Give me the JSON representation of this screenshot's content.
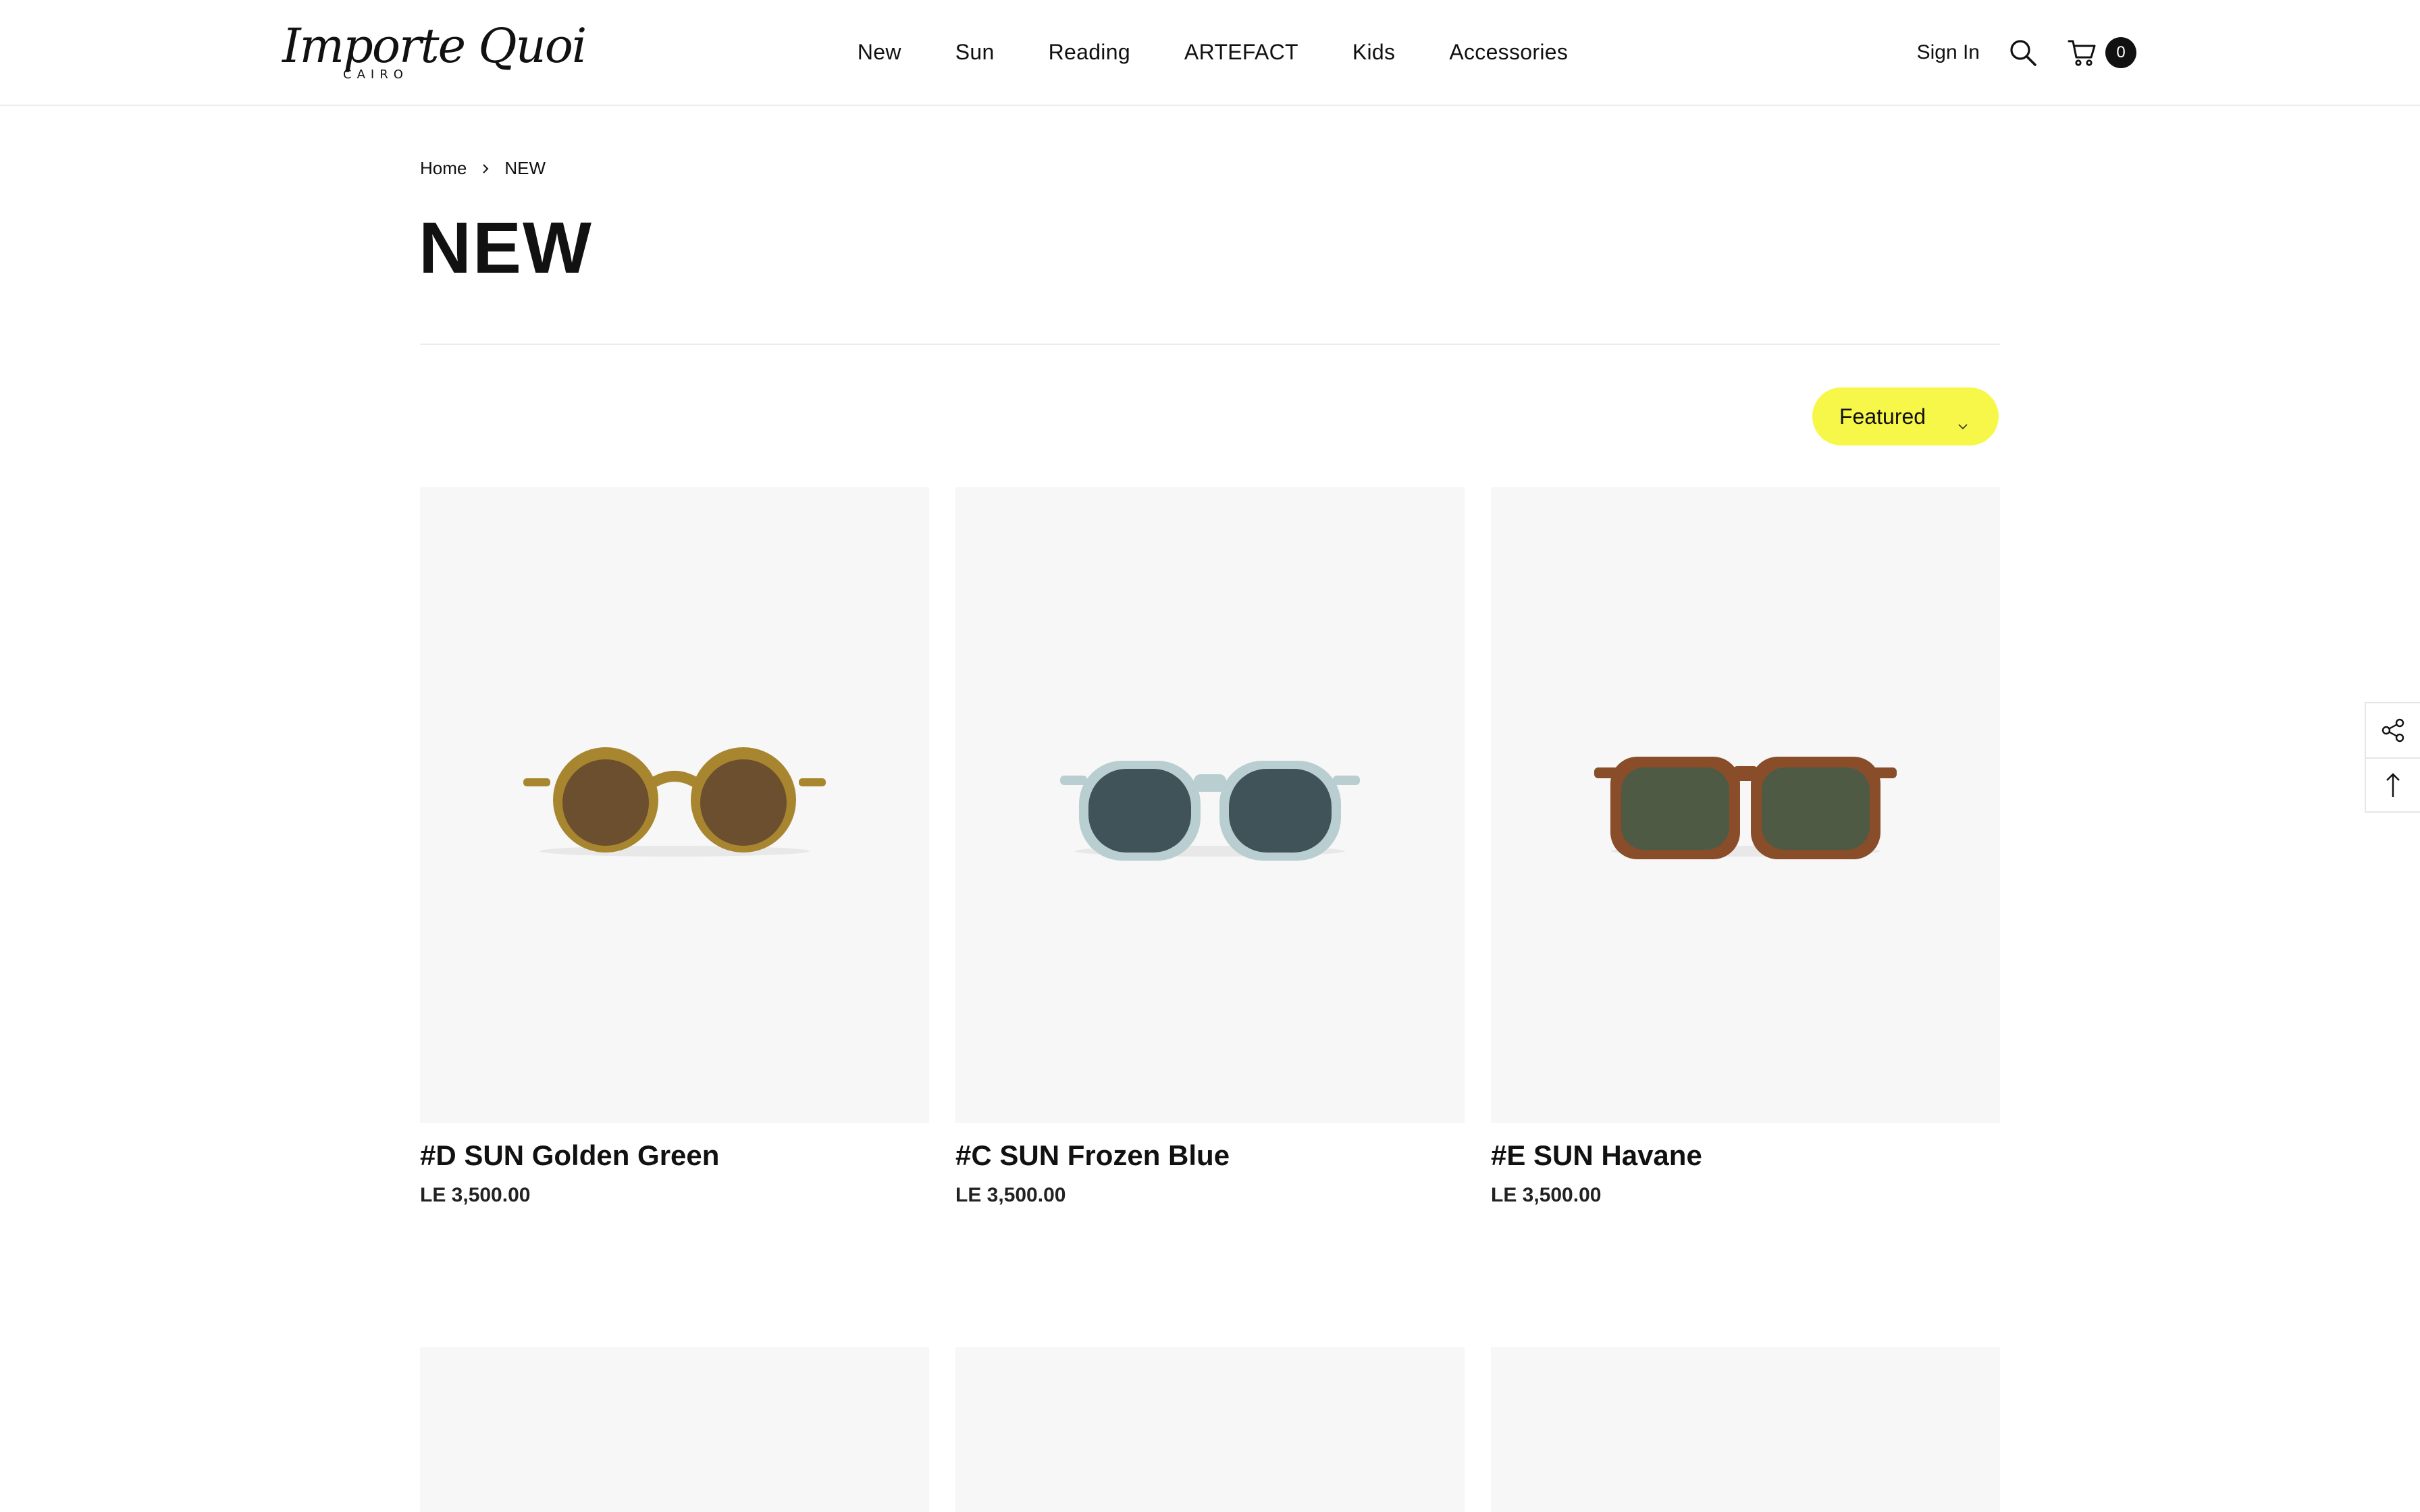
{
  "brand": {
    "logo_script": "Importe Quoi",
    "logo_sub": "CAIRO"
  },
  "nav": {
    "items": [
      {
        "label": "New"
      },
      {
        "label": "Sun"
      },
      {
        "label": "Reading"
      },
      {
        "label": "ARTEFACT"
      },
      {
        "label": "Kids"
      },
      {
        "label": "Accessories"
      }
    ]
  },
  "header": {
    "sign_in": "Sign In",
    "search_icon": "search-icon",
    "cart_icon": "cart-icon",
    "cart_count": "0"
  },
  "breadcrumb": {
    "home": "Home",
    "current": "NEW"
  },
  "page": {
    "title": "NEW"
  },
  "sort": {
    "label": "Featured"
  },
  "products": [
    {
      "title": "#D SUN Golden Green",
      "price": "LE 3,500.00",
      "frame_color": "#a8862f",
      "lens_color": "#6b4f2e"
    },
    {
      "title": "#C SUN Frozen Blue",
      "price": "LE 3,500.00",
      "frame_color": "#b9ced0",
      "lens_color": "#3f5359"
    },
    {
      "title": "#E SUN Havane",
      "price": "LE 3,500.00",
      "frame_color": "#8a4d2a",
      "lens_color": "#4e5a44"
    }
  ],
  "side_tools": {
    "share_icon": "share-icon",
    "back_to_top_icon": "arrow-up-icon"
  },
  "colors": {
    "accent": "#f7f74a",
    "text": "#111111",
    "card_bg": "#f7f7f7"
  }
}
